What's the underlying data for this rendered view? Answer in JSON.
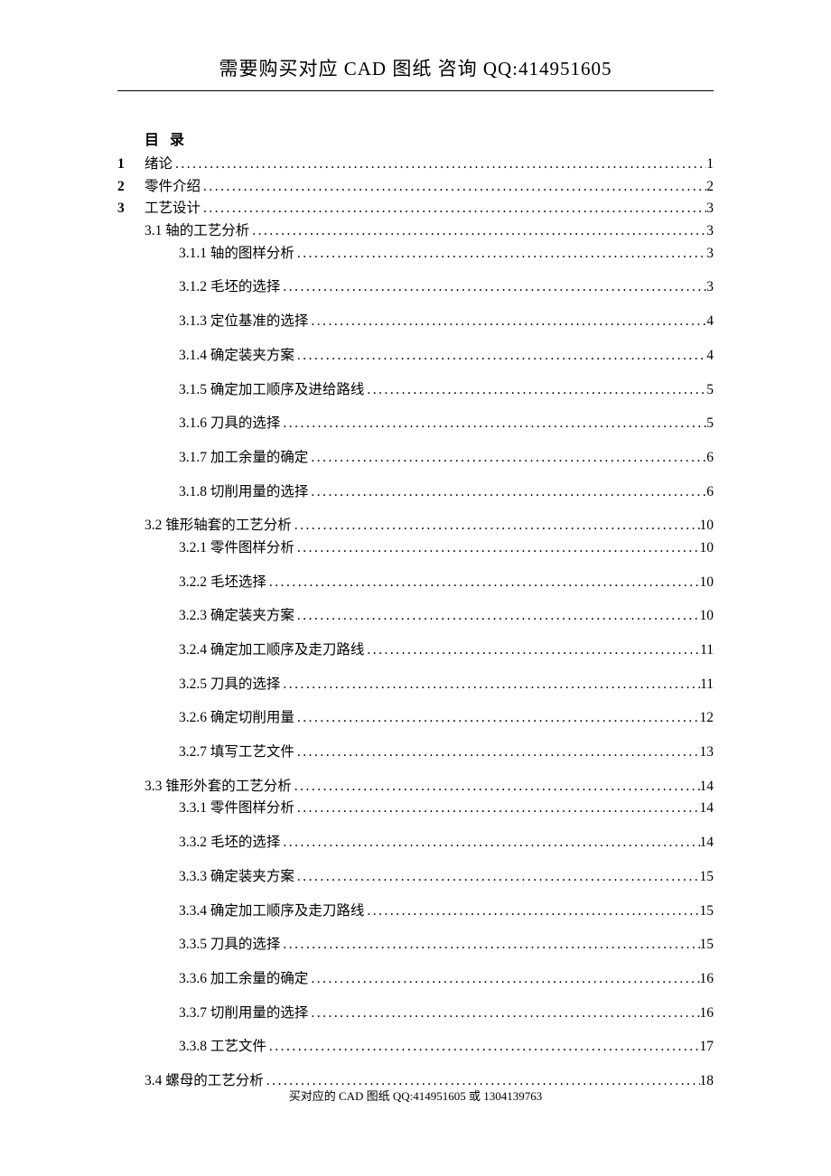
{
  "header": "需要购买对应 CAD 图纸 咨询 QQ:414951605",
  "toc_title": "目 录",
  "entries": [
    {
      "level": 1,
      "chapter": "1",
      "label": "绪论",
      "page": "1"
    },
    {
      "level": 1,
      "chapter": "2",
      "label": "零件介绍",
      "page": "2"
    },
    {
      "level": 1,
      "chapter": "3",
      "label": "工艺设计",
      "page": "3"
    },
    {
      "level": 2,
      "label": "3.1 轴的工艺分析",
      "page": "3"
    },
    {
      "level": 3,
      "label": "3.1.1 轴的图样分析",
      "page": "3"
    },
    {
      "level": 3,
      "label": "3.1.2 毛坯的选择",
      "page": "3"
    },
    {
      "level": 3,
      "label": "3.1.3 定位基准的选择",
      "page": "4"
    },
    {
      "level": 3,
      "label": "3.1.4 确定装夹方案",
      "page": "4"
    },
    {
      "level": 3,
      "label": "3.1.5 确定加工顺序及进给路线",
      "page": "5"
    },
    {
      "level": 3,
      "label": "3.1.6 刀具的选择",
      "page": "5"
    },
    {
      "level": 3,
      "label": "3.1.7 加工余量的确定",
      "page": "6"
    },
    {
      "level": 3,
      "label": "3.1.8 切削用量的选择",
      "page": "6"
    },
    {
      "level": 2,
      "label": "3.2 锥形轴套的工艺分析",
      "page": "10"
    },
    {
      "level": 3,
      "label": "3.2.1 零件图样分析",
      "page": "10"
    },
    {
      "level": 3,
      "label": "3.2.2 毛坯选择",
      "page": "10"
    },
    {
      "level": 3,
      "label": "3.2.3 确定装夹方案",
      "page": "10"
    },
    {
      "level": 3,
      "label": "3.2.4 确定加工顺序及走刀路线",
      "page": "11"
    },
    {
      "level": 3,
      "label": "3.2.5 刀具的选择",
      "page": "11"
    },
    {
      "level": 3,
      "label": "3.2.6 确定切削用量",
      "page": "12"
    },
    {
      "level": 3,
      "label": "3.2.7 填写工艺文件",
      "page": "13"
    },
    {
      "level": 2,
      "label": "3.3 锥形外套的工艺分析",
      "page": "14"
    },
    {
      "level": 3,
      "label": "3.3.1 零件图样分析",
      "page": "14"
    },
    {
      "level": 3,
      "label": "3.3.2 毛坯的选择",
      "page": "14"
    },
    {
      "level": 3,
      "label": "3.3.3 确定装夹方案",
      "page": "15"
    },
    {
      "level": 3,
      "label": "3.3.4 确定加工顺序及走刀路线",
      "page": "15"
    },
    {
      "level": 3,
      "label": "3.3.5 刀具的选择",
      "page": "15"
    },
    {
      "level": 3,
      "label": "3.3.6 加工余量的确定",
      "page": "16"
    },
    {
      "level": 3,
      "label": "3.3.7 切削用量的选择",
      "page": "16"
    },
    {
      "level": 3,
      "label": "3.3.8 工艺文件",
      "page": "17"
    },
    {
      "level": 2,
      "label": "3.4 螺母的工艺分析",
      "page": "18"
    }
  ],
  "footer": "买对应的 CAD 图纸 QQ:414951605 或 1304139763"
}
